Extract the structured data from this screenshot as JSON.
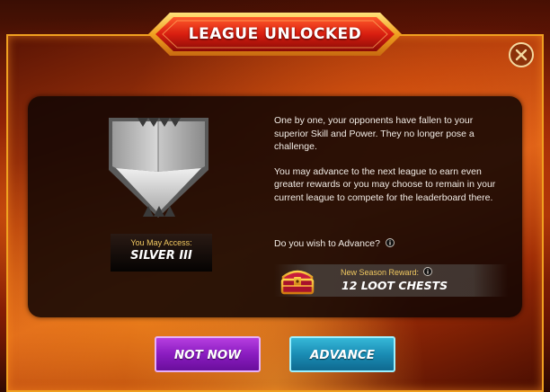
{
  "header": {
    "title": "LEAGUE UNLOCKED"
  },
  "close": {
    "icon": "close-icon"
  },
  "league": {
    "access_label": "You May Access:",
    "name": "SILVER III",
    "badge_icon": "silver-league-shield-icon"
  },
  "message": {
    "paragraph_1": "One by one, your opponents have fallen to your superior Skill and Power. They no longer pose a challenge.",
    "paragraph_2": "You may advance to the next league to earn even greater rewards or you may choose to remain in your current league to compete for the leaderboard there.",
    "question": "Do you wish to Advance?"
  },
  "reward": {
    "label": "New Season Reward:",
    "value": "12 LOOT CHESTS",
    "icon": "loot-chest-icon"
  },
  "buttons": {
    "not_now": "NOT NOW",
    "advance": "ADVANCE"
  },
  "colors": {
    "accent_gold": "#f0a020",
    "not_now_purple": "#8a1cc0",
    "advance_blue": "#1a8cb4",
    "label_gold": "#f0c860"
  }
}
